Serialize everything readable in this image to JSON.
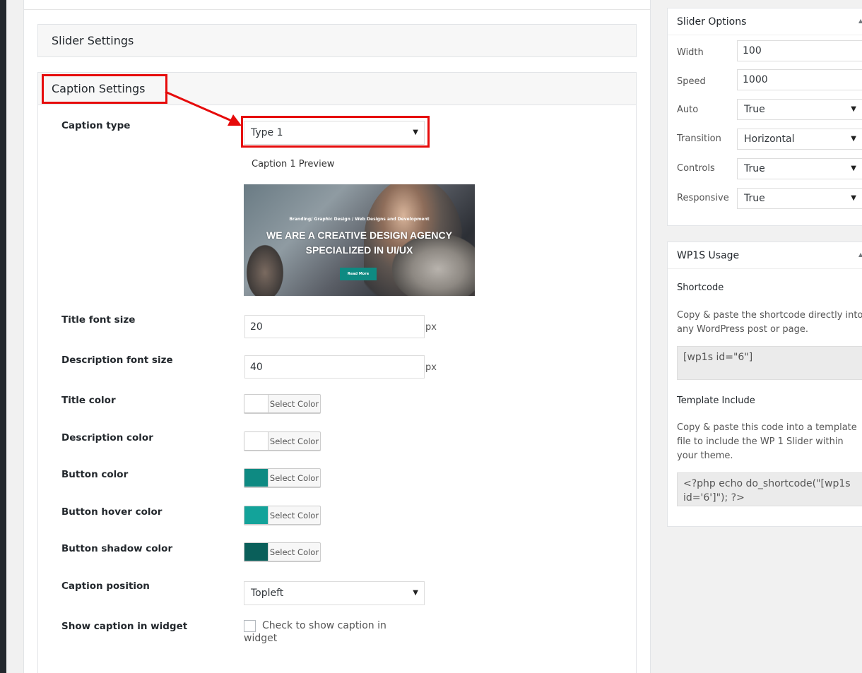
{
  "slider_settings": {
    "title": "Slider Settings"
  },
  "caption_settings": {
    "title": "Caption Settings",
    "caption_type": {
      "label": "Caption type",
      "value": "Type 1"
    },
    "preview": {
      "label": "Caption 1 Preview",
      "tagline": "Branding/ Graphic Design / Web Designs and Development",
      "headline_line1": "WE ARE A  CREATIVE DESIGN AGENCY",
      "headline_line2": "SPECIALIZED IN UI/UX",
      "button": "Read More"
    },
    "title_font_size": {
      "label": "Title font size",
      "value": "20",
      "unit": "px"
    },
    "description_font_size": {
      "label": "Description font size",
      "value": "40",
      "unit": "px"
    },
    "colors": [
      {
        "label": "Title color",
        "button": "Select Color",
        "swatch": "#ffffff"
      },
      {
        "label": "Description color",
        "button": "Select Color",
        "swatch": "#ffffff"
      },
      {
        "label": "Button color",
        "button": "Select Color",
        "swatch": "#0e8a82"
      },
      {
        "label": "Button hover color",
        "button": "Select Color",
        "swatch": "#13a39a"
      },
      {
        "label": "Button shadow color",
        "button": "Select Color",
        "swatch": "#0a5f5a"
      }
    ],
    "caption_position": {
      "label": "Caption position",
      "value": "Topleft"
    },
    "show_in_widget": {
      "label": "Show caption in widget",
      "checkbox_text": "Check to show caption in widget",
      "checked": false
    }
  },
  "slider_options": {
    "title": "Slider Options",
    "fields": [
      {
        "label": "Width",
        "value": "100",
        "kind": "input"
      },
      {
        "label": "Speed",
        "value": "1000",
        "kind": "input"
      },
      {
        "label": "Auto",
        "value": "True",
        "kind": "select"
      },
      {
        "label": "Transition",
        "value": "Horizontal",
        "kind": "select"
      },
      {
        "label": "Controls",
        "value": "True",
        "kind": "select"
      },
      {
        "label": "Responsive",
        "value": "True",
        "kind": "select"
      }
    ]
  },
  "usage": {
    "title": "WP1S Usage",
    "shortcode_heading": "Shortcode",
    "shortcode_desc": "Copy & paste the shortcode directly into any WordPress post or page.",
    "shortcode_value": "[wp1s id=\"6\"]",
    "template_heading": "Template Include",
    "template_desc": "Copy & paste this code into a template file to include the WP 1 Slider within your theme.",
    "template_value": "<?php echo do_shortcode(\"[wp1s id='6']\"); ?>"
  },
  "colors": {
    "highlight": "#e60b0b",
    "accent_teal": "#0e8a82"
  }
}
